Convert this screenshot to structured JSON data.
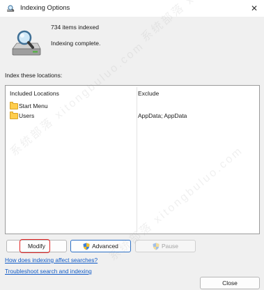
{
  "window": {
    "title": "Indexing Options",
    "close_glyph": "✕"
  },
  "status": {
    "count_text": "734 items indexed",
    "state_text": "Indexing complete."
  },
  "locations": {
    "label": "Index these locations:",
    "columns": {
      "included": "Included Locations",
      "exclude": "Exclude"
    },
    "rows": [
      {
        "name": "Start Menu",
        "exclude": ""
      },
      {
        "name": "Users",
        "exclude": "AppData; AppData"
      }
    ]
  },
  "buttons": {
    "modify": "Modify",
    "advanced": "Advanced",
    "pause": "Pause",
    "close": "Close"
  },
  "links": {
    "how": "How does indexing affect searches?",
    "troubleshoot": "Troubleshoot search and indexing"
  },
  "watermark": {
    "text": "系统部落 xitongbuluo.com"
  },
  "colors": {
    "link": "#0f5ac7",
    "highlight": "#e22424",
    "default_border": "#2b6fc5",
    "folder": "#ffcd4d"
  }
}
